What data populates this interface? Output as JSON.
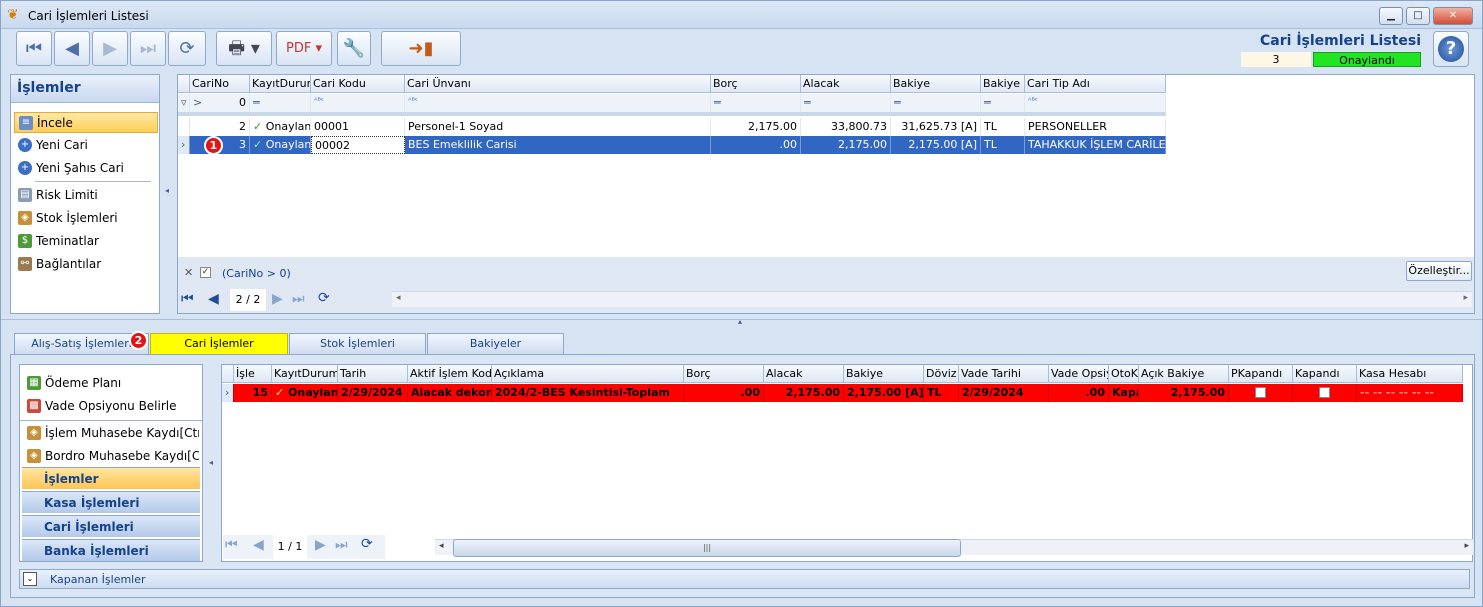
{
  "window": {
    "title": "Cari İşlemleri Listesi"
  },
  "header": {
    "title": "Cari İşlemleri Listesi",
    "count": "3",
    "status": "Onaylandı"
  },
  "nav": {
    "title": "İşlemler",
    "items": [
      "İncele",
      "Yeni Cari",
      "Yeni Şahıs Cari",
      "Risk Limiti",
      "Stok İşlemleri",
      "Teminatlar",
      "Bağlantılar"
    ]
  },
  "top_grid": {
    "columns": [
      "CariNo",
      "KayıtDurumu",
      "Cari Kodu",
      "Cari Ünvanı",
      "Borç",
      "Alacak",
      "Bakiye",
      "Bakiye D",
      "Cari Tip Adı"
    ],
    "filter_value": "0",
    "rows": [
      [
        "2",
        "Onaylan",
        "00001",
        "Personel-1 Soyad",
        "2,175.00",
        "33,800.73",
        "31,625.73 [A]",
        "TL",
        "PERSONELLER"
      ],
      [
        "3",
        "Onaylan",
        "00002",
        "BES Emeklilik Carisi",
        ".00",
        "2,175.00",
        "2,175.00 [A]",
        "TL",
        "TAHAKKUK İŞLEM CARİLERİ"
      ]
    ],
    "filter_text": "(CariNo > 0)",
    "customize": "Özelleştir...",
    "page": "2 / 2"
  },
  "badges": {
    "one": "1",
    "two": "2"
  },
  "tabs": [
    "Alış-Satış İşlemleri",
    "Cari İşlemler",
    "Stok İşlemleri",
    "Bakiyeler"
  ],
  "sub_nav": {
    "items": [
      "Ödeme Planı",
      "Vade Opsiyonu Belirle",
      "İşlem Muhasebe Kaydı[Ctrl...",
      "Bordro Muhasebe Kaydı[Ctr..."
    ],
    "groups": [
      "İşlemler",
      "Kasa İşlemleri",
      "Cari İşlemleri",
      "Banka İşlemleri"
    ]
  },
  "bottom_grid": {
    "columns": [
      "İşle",
      "KayıtDurumu",
      "Tarih",
      "Aktif İşlem Kodu",
      "Açıklama",
      "Borç",
      "Alacak",
      "Bakiye",
      "Döviz",
      "Vade Tarihi",
      "Vade Opsiyo",
      "OtoKa",
      "Açık Bakiye",
      "PKapandı",
      "Kapandı",
      "Kasa Hesabı"
    ],
    "row": [
      "15",
      "Onaylan",
      "2/29/2024",
      "Alacak dekont",
      "2024/2-BES Kesintisi-Toplam",
      ".00",
      "2,175.00",
      "2,175.00 [A]",
      "TL",
      "2/29/2024",
      ".00",
      "Kapa",
      "2,175.00",
      "",
      "",
      "-- -- -- -- -- --"
    ],
    "page": "1 / 1"
  },
  "footer": {
    "label": "Kapanan İşlemler"
  }
}
